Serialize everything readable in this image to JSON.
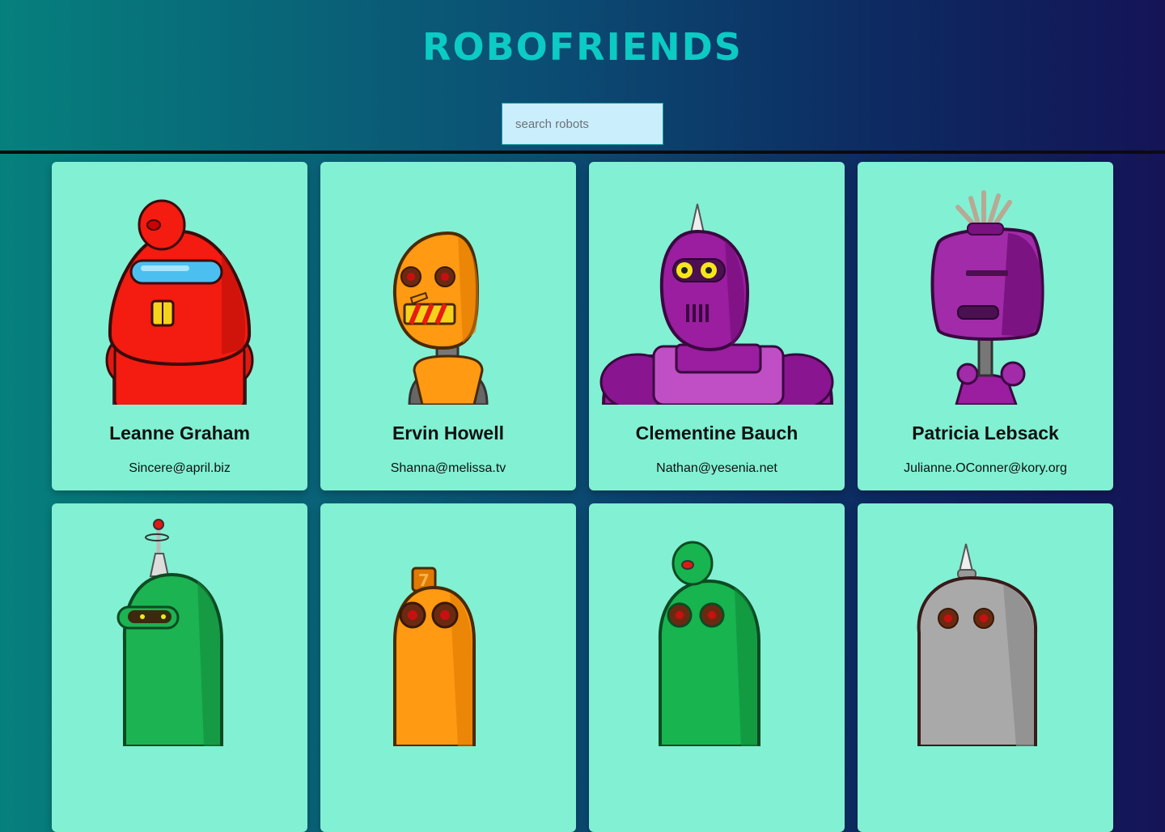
{
  "header": {
    "title": "ROBOFRIENDS"
  },
  "search": {
    "placeholder": "search robots",
    "value": ""
  },
  "robots": [
    {
      "name": "Leanne Graham",
      "email": "Sincere@april.biz",
      "color": "#f41b10",
      "icon": "red-robot-avatar-icon"
    },
    {
      "name": "Ervin Howell",
      "email": "Shanna@melissa.tv",
      "color": "#ff9a12",
      "icon": "orange-robot-avatar-icon"
    },
    {
      "name": "Clementine Bauch",
      "email": "Nathan@yesenia.net",
      "color": "#9b1da0",
      "icon": "purple-robot-avatar-icon"
    },
    {
      "name": "Patricia Lebsack",
      "email": "Julianne.OConner@kory.org",
      "color": "#a12ba8",
      "icon": "purple-cube-robot-avatar-icon"
    },
    {
      "name": "",
      "email": "",
      "color": "#1cb352",
      "icon": "green-robot-avatar-icon"
    },
    {
      "name": "",
      "email": "",
      "color": "#ff9a12",
      "icon": "orange-robot-avatar-icon"
    },
    {
      "name": "",
      "email": "",
      "color": "#17b44f",
      "icon": "green-robot-avatar-icon"
    },
    {
      "name": "",
      "email": "",
      "color": "#a9a9a9",
      "icon": "gray-robot-avatar-icon"
    }
  ]
}
